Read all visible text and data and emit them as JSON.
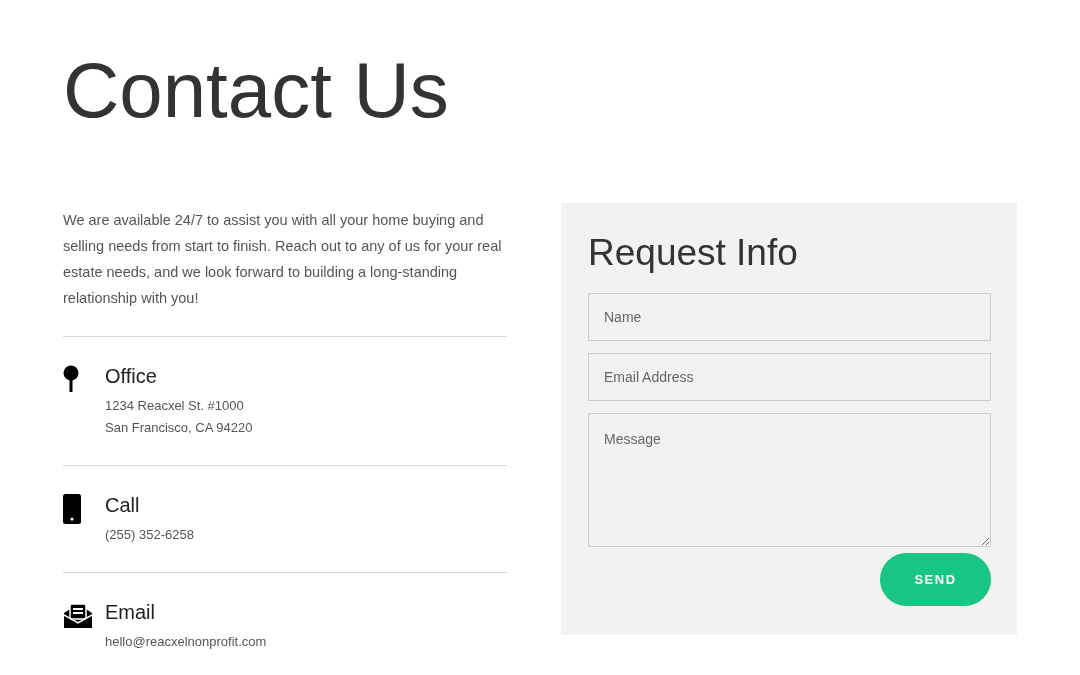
{
  "title": "Contact Us",
  "intro": "We are available 24/7 to assist you with all your home buying and selling needs from start to finish. Reach out to any of us for your real estate needs, and we look forward to building a long-standing relationship with you!",
  "contacts": [
    {
      "kind": "pin",
      "heading": "Office",
      "lines": [
        "1234 Reacxel St. #1000",
        "San Francisco, CA 94220"
      ]
    },
    {
      "kind": "phone",
      "heading": "Call",
      "lines": [
        "(255) 352-6258"
      ]
    },
    {
      "kind": "mail",
      "heading": "Email",
      "lines": [
        "hello@reacxelnonprofit.com"
      ]
    }
  ],
  "form": {
    "title": "Request Info",
    "fields": [
      {
        "kind": "input",
        "placeholder": "Name"
      },
      {
        "kind": "input",
        "placeholder": "Email Address"
      },
      {
        "kind": "textarea",
        "placeholder": "Message"
      }
    ],
    "button": "SEND"
  }
}
